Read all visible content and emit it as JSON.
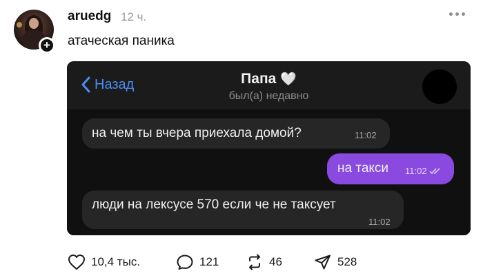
{
  "post": {
    "username": "aruedg",
    "time": "12 ч.",
    "text": "атаческая паника",
    "more_icon": "more-dots-icon",
    "follow_icon": "plus-icon"
  },
  "chat": {
    "back_label": "Назад",
    "contact_name": "Папа",
    "contact_heart": "🤍",
    "status": "был(а) недавно",
    "messages": [
      {
        "direction": "in",
        "text": "на чем ты вчера приехала домой?",
        "time": "11:02"
      },
      {
        "direction": "out",
        "text": "на такси",
        "time": "11:02",
        "read_icon": "double-check-icon"
      },
      {
        "direction": "in",
        "text": "люди на лексусе 570 если че не таксует",
        "time": "11:02"
      }
    ]
  },
  "actions": {
    "likes": "10,4 тыс.",
    "replies": "121",
    "reposts": "46",
    "shares": "528"
  },
  "colors": {
    "accent_blue": "#4a8ef0",
    "outgoing_bubble": "#8a4ae0",
    "incoming_bubble": "#262626"
  }
}
